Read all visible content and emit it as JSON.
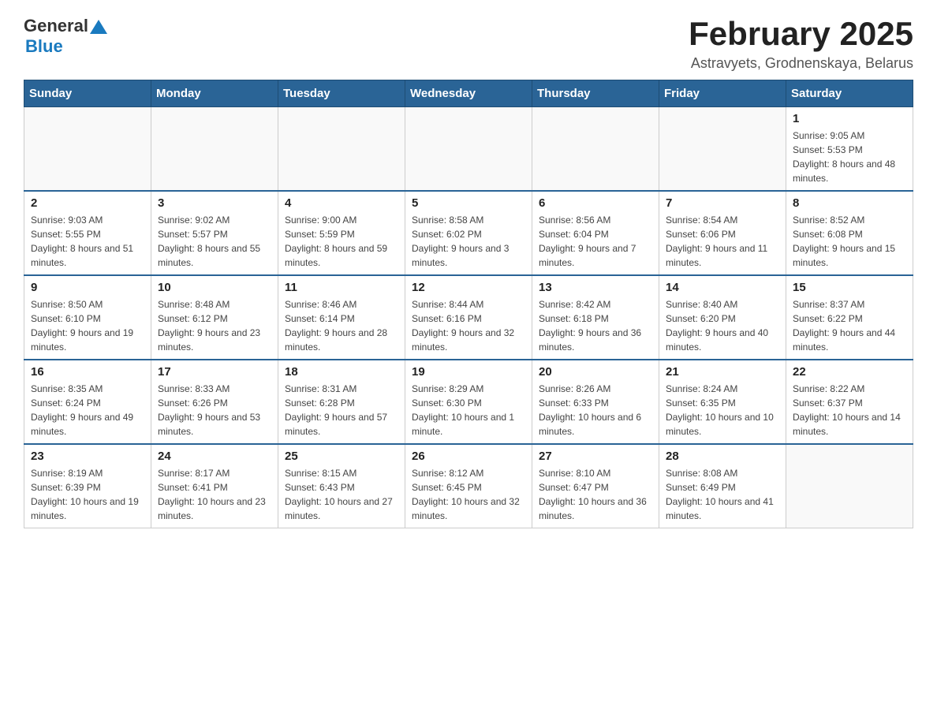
{
  "header": {
    "logo": {
      "general": "General",
      "blue": "Blue",
      "triangle": "▲"
    },
    "month_year": "February 2025",
    "location": "Astravyets, Grodnenskaya, Belarus"
  },
  "weekdays": [
    "Sunday",
    "Monday",
    "Tuesday",
    "Wednesday",
    "Thursday",
    "Friday",
    "Saturday"
  ],
  "weeks": [
    [
      {
        "day": "",
        "info": ""
      },
      {
        "day": "",
        "info": ""
      },
      {
        "day": "",
        "info": ""
      },
      {
        "day": "",
        "info": ""
      },
      {
        "day": "",
        "info": ""
      },
      {
        "day": "",
        "info": ""
      },
      {
        "day": "1",
        "info": "Sunrise: 9:05 AM\nSunset: 5:53 PM\nDaylight: 8 hours and 48 minutes."
      }
    ],
    [
      {
        "day": "2",
        "info": "Sunrise: 9:03 AM\nSunset: 5:55 PM\nDaylight: 8 hours and 51 minutes."
      },
      {
        "day": "3",
        "info": "Sunrise: 9:02 AM\nSunset: 5:57 PM\nDaylight: 8 hours and 55 minutes."
      },
      {
        "day": "4",
        "info": "Sunrise: 9:00 AM\nSunset: 5:59 PM\nDaylight: 8 hours and 59 minutes."
      },
      {
        "day": "5",
        "info": "Sunrise: 8:58 AM\nSunset: 6:02 PM\nDaylight: 9 hours and 3 minutes."
      },
      {
        "day": "6",
        "info": "Sunrise: 8:56 AM\nSunset: 6:04 PM\nDaylight: 9 hours and 7 minutes."
      },
      {
        "day": "7",
        "info": "Sunrise: 8:54 AM\nSunset: 6:06 PM\nDaylight: 9 hours and 11 minutes."
      },
      {
        "day": "8",
        "info": "Sunrise: 8:52 AM\nSunset: 6:08 PM\nDaylight: 9 hours and 15 minutes."
      }
    ],
    [
      {
        "day": "9",
        "info": "Sunrise: 8:50 AM\nSunset: 6:10 PM\nDaylight: 9 hours and 19 minutes."
      },
      {
        "day": "10",
        "info": "Sunrise: 8:48 AM\nSunset: 6:12 PM\nDaylight: 9 hours and 23 minutes."
      },
      {
        "day": "11",
        "info": "Sunrise: 8:46 AM\nSunset: 6:14 PM\nDaylight: 9 hours and 28 minutes."
      },
      {
        "day": "12",
        "info": "Sunrise: 8:44 AM\nSunset: 6:16 PM\nDaylight: 9 hours and 32 minutes."
      },
      {
        "day": "13",
        "info": "Sunrise: 8:42 AM\nSunset: 6:18 PM\nDaylight: 9 hours and 36 minutes."
      },
      {
        "day": "14",
        "info": "Sunrise: 8:40 AM\nSunset: 6:20 PM\nDaylight: 9 hours and 40 minutes."
      },
      {
        "day": "15",
        "info": "Sunrise: 8:37 AM\nSunset: 6:22 PM\nDaylight: 9 hours and 44 minutes."
      }
    ],
    [
      {
        "day": "16",
        "info": "Sunrise: 8:35 AM\nSunset: 6:24 PM\nDaylight: 9 hours and 49 minutes."
      },
      {
        "day": "17",
        "info": "Sunrise: 8:33 AM\nSunset: 6:26 PM\nDaylight: 9 hours and 53 minutes."
      },
      {
        "day": "18",
        "info": "Sunrise: 8:31 AM\nSunset: 6:28 PM\nDaylight: 9 hours and 57 minutes."
      },
      {
        "day": "19",
        "info": "Sunrise: 8:29 AM\nSunset: 6:30 PM\nDaylight: 10 hours and 1 minute."
      },
      {
        "day": "20",
        "info": "Sunrise: 8:26 AM\nSunset: 6:33 PM\nDaylight: 10 hours and 6 minutes."
      },
      {
        "day": "21",
        "info": "Sunrise: 8:24 AM\nSunset: 6:35 PM\nDaylight: 10 hours and 10 minutes."
      },
      {
        "day": "22",
        "info": "Sunrise: 8:22 AM\nSunset: 6:37 PM\nDaylight: 10 hours and 14 minutes."
      }
    ],
    [
      {
        "day": "23",
        "info": "Sunrise: 8:19 AM\nSunset: 6:39 PM\nDaylight: 10 hours and 19 minutes."
      },
      {
        "day": "24",
        "info": "Sunrise: 8:17 AM\nSunset: 6:41 PM\nDaylight: 10 hours and 23 minutes."
      },
      {
        "day": "25",
        "info": "Sunrise: 8:15 AM\nSunset: 6:43 PM\nDaylight: 10 hours and 27 minutes."
      },
      {
        "day": "26",
        "info": "Sunrise: 8:12 AM\nSunset: 6:45 PM\nDaylight: 10 hours and 32 minutes."
      },
      {
        "day": "27",
        "info": "Sunrise: 8:10 AM\nSunset: 6:47 PM\nDaylight: 10 hours and 36 minutes."
      },
      {
        "day": "28",
        "info": "Sunrise: 8:08 AM\nSunset: 6:49 PM\nDaylight: 10 hours and 41 minutes."
      },
      {
        "day": "",
        "info": ""
      }
    ]
  ]
}
